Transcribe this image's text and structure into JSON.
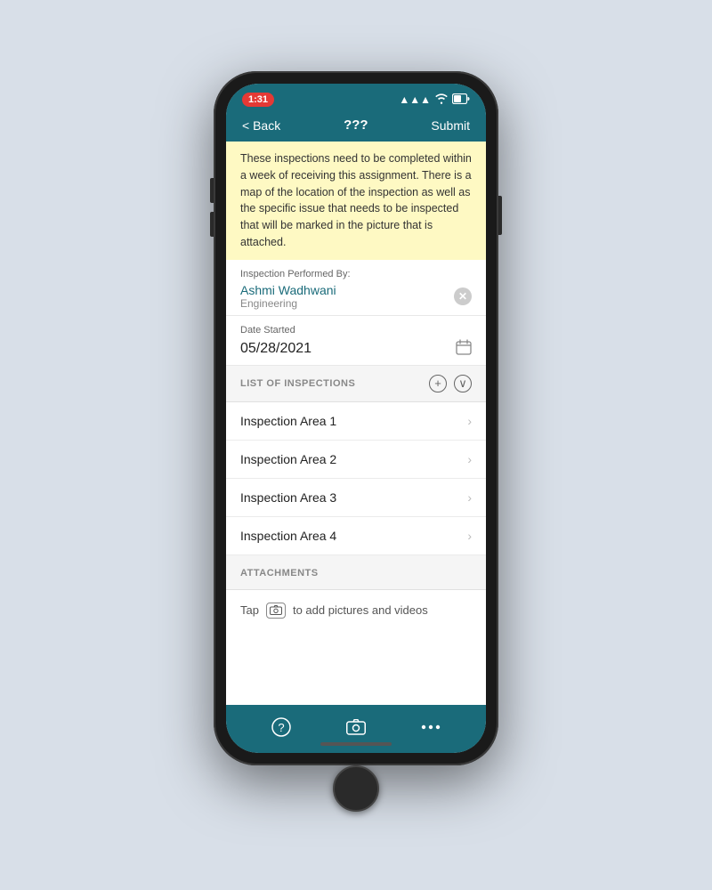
{
  "status_bar": {
    "time": "1:31",
    "signal": "▲▲▲",
    "wifi": "wifi",
    "battery": "battery"
  },
  "nav": {
    "back_label": "< Back",
    "title": "???",
    "submit_label": "Submit"
  },
  "note": {
    "text": "These inspections need to be completed within a week of receiving this assignment. There is a map of the location of the inspection as well as the specific issue that needs to be inspected that will be marked in the picture that is attached."
  },
  "inspector": {
    "label": "Inspection Performed By:",
    "name": "Ashmi Wadhwani",
    "department": "Engineering"
  },
  "date": {
    "label": "Date Started",
    "value": "05/28/2021"
  },
  "list_header": {
    "title": "LIST OF INSPECTIONS"
  },
  "inspections": [
    {
      "label": "Inspection Area 1"
    },
    {
      "label": "Inspection Area 2"
    },
    {
      "label": "Inspection Area 3"
    },
    {
      "label": "Inspection Area 4"
    }
  ],
  "attachments": {
    "title": "ATTACHMENTS",
    "tap_text": "Tap",
    "tap_suffix": "to add pictures and videos"
  },
  "toolbar": {
    "help_icon": "?",
    "camera_icon": "⊙",
    "more_icon": "•••"
  }
}
